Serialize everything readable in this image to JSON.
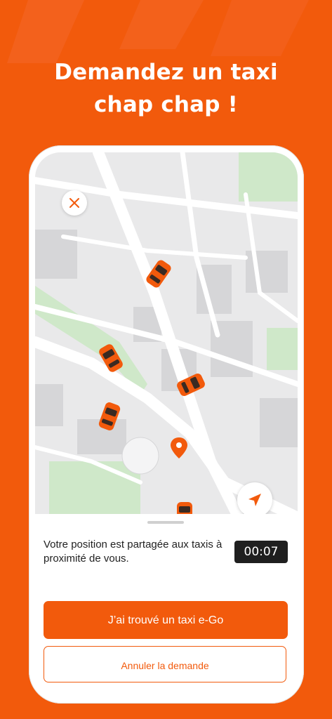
{
  "colors": {
    "brand": "#F25A0C",
    "map_bg": "#E9E9EA",
    "park": "#CFE8C9",
    "timer_bg": "#1F1F1F"
  },
  "headline": {
    "line1": "Demandez un taxi",
    "line2": "chap chap !"
  },
  "map": {
    "close_icon": "close-icon",
    "locate_icon": "navigation-arrow-icon",
    "pin_icon": "location-pin-icon",
    "taxi_icon": "taxi-car-icon"
  },
  "sheet": {
    "status_text": "Votre position est partagée aux taxis à proximité de vous.",
    "timer": "00:07",
    "primary_label": "J’ai trouvé un taxi e-Go",
    "secondary_label": "Annuler la demande"
  }
}
